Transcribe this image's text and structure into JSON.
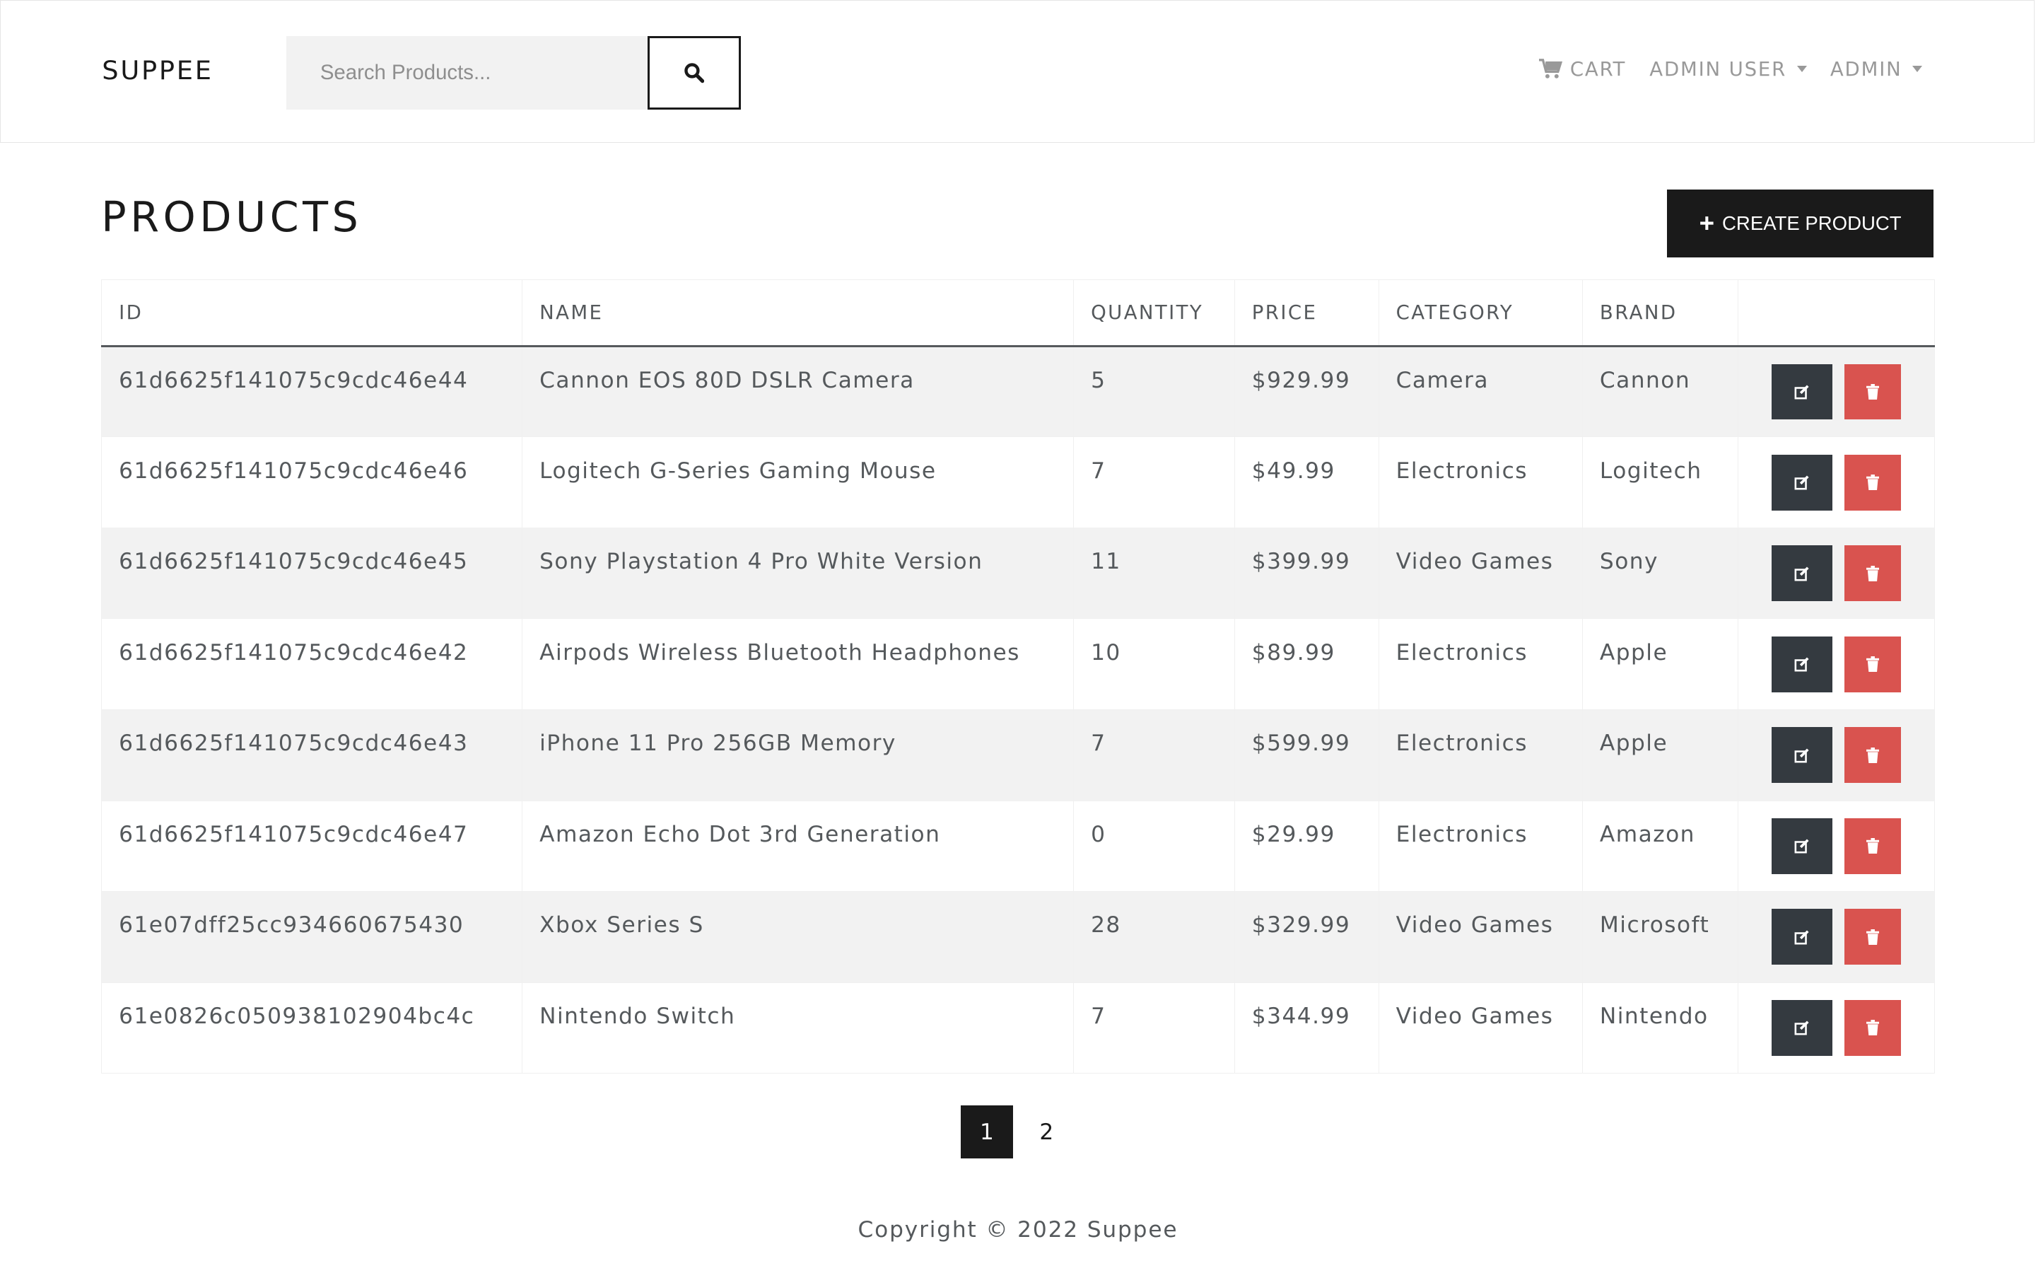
{
  "header": {
    "brand": "SUPPEE",
    "search_placeholder": "Search Products...",
    "search_icon": "search-icon",
    "nav": [
      {
        "label": "CART",
        "icon": "cart-icon"
      },
      {
        "label": "ADMIN USER"
      },
      {
        "label": "ADMIN"
      }
    ]
  },
  "main": {
    "title": "PRODUCTS",
    "create_label": "CREATE PRODUCT",
    "columns": [
      "ID",
      "NAME",
      "QUANTITY",
      "PRICE",
      "CATEGORY",
      "BRAND",
      ""
    ],
    "rows": [
      {
        "id": "61d6625f141075c9cdc46e44",
        "name": "Cannon EOS 80D DSLR Camera",
        "qty": "5",
        "price": "$929.99",
        "category": "Camera",
        "brand": "Cannon"
      },
      {
        "id": "61d6625f141075c9cdc46e46",
        "name": "Logitech G-Series Gaming Mouse",
        "qty": "7",
        "price": "$49.99",
        "category": "Electronics",
        "brand": "Logitech"
      },
      {
        "id": "61d6625f141075c9cdc46e45",
        "name": "Sony Playstation 4 Pro White Version",
        "qty": "11",
        "price": "$399.99",
        "category": "Video Games",
        "brand": "Sony"
      },
      {
        "id": "61d6625f141075c9cdc46e42",
        "name": "Airpods Wireless Bluetooth Headphones",
        "qty": "10",
        "price": "$89.99",
        "category": "Electronics",
        "brand": "Apple"
      },
      {
        "id": "61d6625f141075c9cdc46e43",
        "name": "iPhone 11 Pro 256GB Memory",
        "qty": "7",
        "price": "$599.99",
        "category": "Electronics",
        "brand": "Apple"
      },
      {
        "id": "61d6625f141075c9cdc46e47",
        "name": "Amazon Echo Dot 3rd Generation",
        "qty": "0",
        "price": "$29.99",
        "category": "Electronics",
        "brand": "Amazon"
      },
      {
        "id": "61e07dff25cc934660675430",
        "name": "Xbox Series S",
        "qty": "28",
        "price": "$329.99",
        "category": "Video Games",
        "brand": "Microsoft"
      },
      {
        "id": "61e0826c050938102904bc4c",
        "name": "Nintendo Switch",
        "qty": "7",
        "price": "$344.99",
        "category": "Video Games",
        "brand": "Nintendo"
      }
    ],
    "pagination": [
      "1",
      "2"
    ],
    "active_page": "1"
  },
  "footer": {
    "text": "Copyright © 2022 Suppee"
  },
  "colors": {
    "dark": "#1a1a1a",
    "edit": "#343a40",
    "delete": "#d9534f",
    "stripe": "#f2f2f2"
  }
}
